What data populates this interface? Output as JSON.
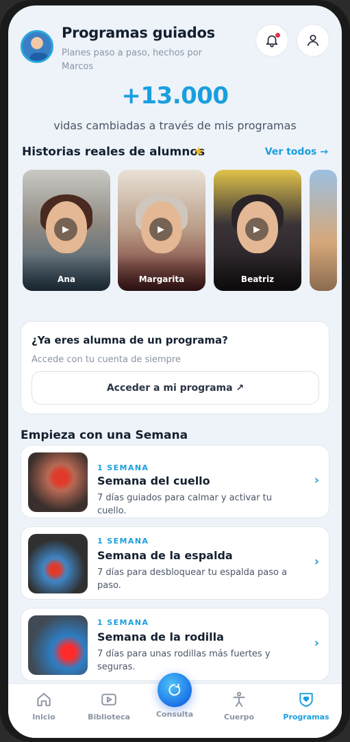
{
  "header": {
    "title": "Programas guiados",
    "subtitle": "Planes paso a paso, hechos por Marcos"
  },
  "hero": {
    "stat": "+13.000",
    "caption": "vidas cambiadas a través de mis programas"
  },
  "stories": {
    "title": "Historias reales de alumnos",
    "title_icon": "star-icon",
    "see_all": "Ver todos →",
    "items": [
      {
        "name": "Ana"
      },
      {
        "name": "Margarita"
      },
      {
        "name": "Beatriz"
      },
      {
        "name": ""
      }
    ]
  },
  "login_card": {
    "title": "¿Ya eres alumna de un programa?",
    "subtitle": "Accede con tu cuenta de siempre",
    "button": "Acceder a mi programa ↗"
  },
  "weeks": {
    "title": "Empieza con una Semana",
    "items": [
      {
        "tag": "1 SEMANA",
        "name": "Semana del cuello",
        "description": "7 días guiados para calmar y activar tu cuello."
      },
      {
        "tag": "1 SEMANA",
        "name": "Semana de la espalda",
        "description": "7 días para desbloquear tu espalda paso a paso."
      },
      {
        "tag": "1 SEMANA",
        "name": "Semana de la rodilla",
        "description": "7 días para unas rodillas más fuertes y seguras."
      }
    ]
  },
  "nav": {
    "items": [
      {
        "label": "Inicio",
        "icon": "home-icon"
      },
      {
        "label": "Biblioteca",
        "icon": "video-library-icon"
      },
      {
        "label": "Consulta",
        "icon": "chat-icon"
      },
      {
        "label": "Cuerpo",
        "icon": "body-icon"
      },
      {
        "label": "Programas",
        "icon": "shield-heart-icon"
      }
    ],
    "active": "Programas"
  },
  "colors": {
    "accent": "#1a9fde",
    "background": "#eef3f9",
    "notification": "#e0324b"
  }
}
